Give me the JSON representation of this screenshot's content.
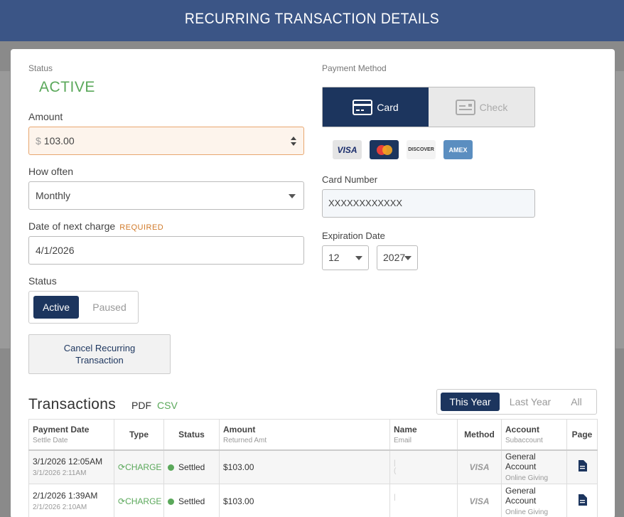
{
  "header": {
    "title": "RECURRING TRANSACTION DETAILS"
  },
  "left": {
    "status_label": "Status",
    "status_value": "ACTIVE",
    "amount_label": "Amount",
    "amount_currency": "$",
    "amount_value": "103.00",
    "how_often_label": "How often",
    "how_often_value": "Monthly",
    "next_charge_label": "Date of next charge",
    "required_tag": "REQUIRED",
    "next_charge_value": "4/1/2026",
    "status_toggle_label": "Status",
    "status_options": [
      "Active",
      "Paused"
    ],
    "cancel_button": "Cancel Recurring Transaction"
  },
  "right": {
    "payment_method_label": "Payment Method",
    "payment_options": [
      "Card",
      "Check"
    ],
    "card_brands": [
      "VISA",
      "MC",
      "DISCOVER",
      "AMEX"
    ],
    "card_number_label": "Card Number",
    "card_number_value": "XXXXXXXXXXXX",
    "expiration_label": "Expiration Date",
    "exp_month": "12",
    "exp_year": "2027"
  },
  "transactions": {
    "title": "Transactions",
    "pdf_link": "PDF",
    "csv_link": "CSV",
    "range_options": [
      "This Year",
      "Last Year",
      "All"
    ],
    "columns": [
      {
        "main": "Payment Date",
        "sub": "Settle Date"
      },
      {
        "main": "Type",
        "sub": ""
      },
      {
        "main": "Status",
        "sub": ""
      },
      {
        "main": "Amount",
        "sub": "Returned Amt"
      },
      {
        "main": "Name",
        "sub": "Email"
      },
      {
        "main": "Method",
        "sub": ""
      },
      {
        "main": "Account",
        "sub": "Subaccount"
      },
      {
        "main": "Page",
        "sub": ""
      }
    ],
    "rows": [
      {
        "date": "3/1/2026 12:05AM",
        "settle": "3/1/2026 2:11AM",
        "type": "CHARGE",
        "status": "Settled",
        "amount": "$103.00",
        "method": "VISA",
        "account": "General Account",
        "subaccount": "Online Giving"
      },
      {
        "date": "2/1/2026 1:39AM",
        "settle": "2/1/2026 2:10AM",
        "type": "CHARGE",
        "status": "Settled",
        "amount": "$103.00",
        "method": "VISA",
        "account": "General Account",
        "subaccount": "Online Giving"
      }
    ]
  },
  "colors": {
    "header": "#3b5586",
    "primary": "#1c355e",
    "success": "#5aa85a",
    "warning": "#d17a2a"
  }
}
